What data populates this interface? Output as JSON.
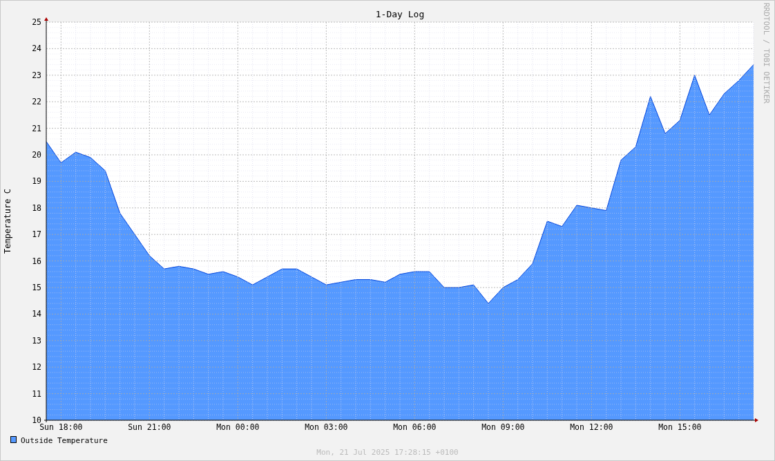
{
  "graph": {
    "credit": "RRDTOOL / TOBI OETIKER",
    "chart_data": {
      "type": "area",
      "title": "1-Day Log",
      "ylabel": "Temperature C",
      "categories": [
        null,
        "Sun 18:00",
        null,
        null,
        null,
        null,
        null,
        "Sun 21:00",
        null,
        null,
        null,
        null,
        null,
        "Mon 00:00",
        null,
        null,
        null,
        null,
        null,
        "Mon 03:00",
        null,
        null,
        null,
        null,
        null,
        "Mon 06:00",
        null,
        null,
        null,
        null,
        null,
        "Mon 09:00",
        null,
        null,
        null,
        null,
        null,
        "Mon 12:00",
        null,
        null,
        null,
        null,
        null,
        "Mon 15:00",
        null,
        null,
        null,
        null,
        null
      ],
      "series": [
        {
          "name": "Outside Temperature",
          "color": "#5599ff",
          "values": [
            20.5,
            19.7,
            20.1,
            19.9,
            19.4,
            17.8,
            17.0,
            16.2,
            15.7,
            15.8,
            15.7,
            15.5,
            15.6,
            15.4,
            15.1,
            15.4,
            15.7,
            15.7,
            15.4,
            15.1,
            15.2,
            15.3,
            15.3,
            15.2,
            15.5,
            15.6,
            15.6,
            15.0,
            15.0,
            15.1,
            14.4,
            15.0,
            15.3,
            15.9,
            17.5,
            17.3,
            18.1,
            18.0,
            17.9,
            19.8,
            20.3,
            22.2,
            20.8,
            21.3,
            23.0,
            21.5,
            22.3,
            22.8,
            23.4
          ]
        }
      ],
      "ylim": [
        10,
        25
      ],
      "grid": true,
      "yticks": [
        10,
        11,
        12,
        13,
        14,
        15,
        16,
        17,
        18,
        19,
        20,
        21,
        22,
        23,
        24,
        25
      ]
    },
    "timestamp": "Mon, 21 Jul 2025 17:28:15 +0100"
  }
}
